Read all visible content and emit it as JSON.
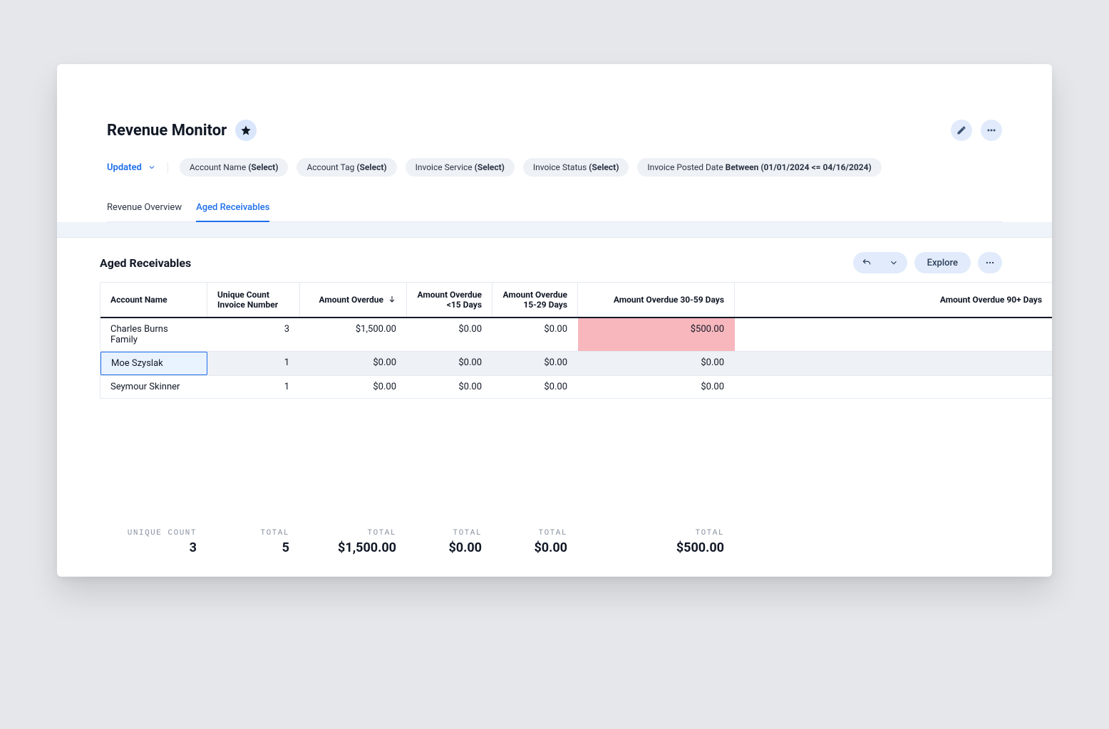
{
  "header": {
    "title": "Revenue Monitor",
    "updated_label": "Updated"
  },
  "filters": [
    {
      "label": "Account Name",
      "value": "(Select)"
    },
    {
      "label": "Account Tag",
      "value": "(Select)"
    },
    {
      "label": "Invoice Service",
      "value": "(Select)"
    },
    {
      "label": "Invoice Status",
      "value": "(Select)"
    },
    {
      "label": "Invoice Posted Date",
      "value": "Between (01/01/2024 <= 04/16/2024)"
    }
  ],
  "tabs": [
    {
      "label": "Revenue Overview",
      "active": false
    },
    {
      "label": "Aged Receivables",
      "active": true
    }
  ],
  "section": {
    "title": "Aged Receivables",
    "explore_label": "Explore"
  },
  "table": {
    "columns": [
      {
        "label": "Account Name",
        "align": "left"
      },
      {
        "label": "Unique Count Invoice Number",
        "align": "left"
      },
      {
        "label": "Amount Overdue",
        "align": "right",
        "sort": "desc"
      },
      {
        "label": "Amount Overdue <15 Days",
        "align": "right"
      },
      {
        "label": "Amount Overdue 15-29 Days",
        "align": "right"
      },
      {
        "label": "Amount Overdue 30-59 Days",
        "align": "right"
      },
      {
        "label": "Amount Overdue 90+ Days",
        "align": "right"
      }
    ],
    "rows": [
      {
        "name": "Charles Burns Family",
        "unique": "3",
        "overdue": "$1,500.00",
        "lt15": "$0.00",
        "d15_29": "$0.00",
        "d30_59": "$500.00",
        "d90": "",
        "highlight_30_59": true,
        "selected": false
      },
      {
        "name": "Moe Szyslak",
        "unique": "1",
        "overdue": "$0.00",
        "lt15": "$0.00",
        "d15_29": "$0.00",
        "d30_59": "$0.00",
        "d90": "",
        "highlight_30_59": false,
        "selected": true,
        "alt": true
      },
      {
        "name": "Seymour Skinner",
        "unique": "1",
        "overdue": "$0.00",
        "lt15": "$0.00",
        "d15_29": "$0.00",
        "d30_59": "$0.00",
        "d90": "",
        "highlight_30_59": false,
        "selected": false
      }
    ]
  },
  "totals": {
    "unique_label": "UNIQUE COUNT",
    "unique_value": "3",
    "total_label": "TOTAL",
    "count": "5",
    "overdue": "$1,500.00",
    "lt15": "$0.00",
    "d15_29": "$0.00",
    "d30_59": "$500.00"
  }
}
